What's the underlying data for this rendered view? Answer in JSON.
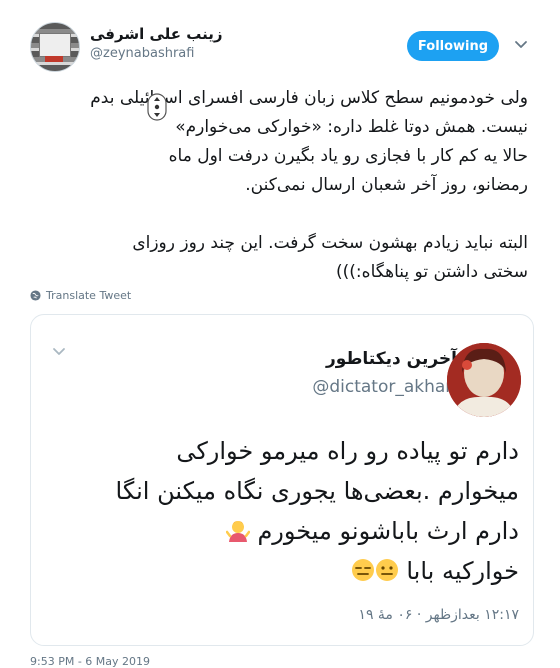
{
  "author": {
    "name": "زینب علی اشرفی",
    "handle": "@zeynabashrafi"
  },
  "follow_label": "Following",
  "tweet_lines": [
    "ولی خودمونیم سطح کلاس زبان فارسی افسرای اسرائیلی بدم",
    "نیست. همش دوتا غلط داره: «خوارکی می‌خوارم»",
    "حالا یه کم کار با فجازی رو یاد بگیرن درفت اول ماه",
    "رمضانو، روز آخر شعبان ارسال نمی‌کنن.",
    "البته نباید زیادم بهشون سخت گرفت. این چند روز روزای",
    "سختی داشتن تو پناهگاه:)))"
  ],
  "translate_label": "Translate Tweet",
  "quoted": {
    "name": "آخرین دیکتاطور",
    "handle": "@dictator_akhari",
    "lines": [
      "دارم تو پیاده رو راه میرمو خوارکی",
      "میخوارم .بعضی‌ها یجوری نگاه میکنن انگا",
      "دارم ارث باباشونو میخورم",
      "خوارکیه بابا"
    ],
    "timestamp": "۱۲:۱۷ بعدازظهر · ۰۶ مهٔ ۱۹"
  },
  "footer_meta": "9:53 PM - 6 May 2019",
  "colors": {
    "accent": "#1da1f2",
    "secondary_text": "#657786",
    "border": "#e1e8ed"
  },
  "icons": [
    "chevron-down-icon",
    "globe-icon",
    "shrug-emoji",
    "neutral-face-emoji",
    "expressionless-face-emoji"
  ]
}
